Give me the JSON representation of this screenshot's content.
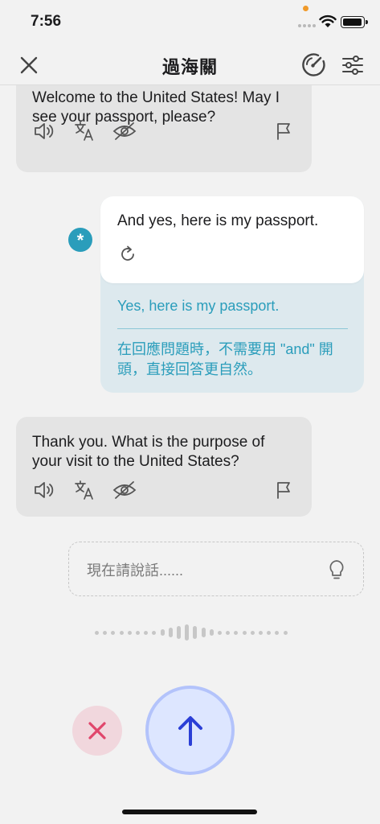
{
  "status_bar": {
    "time": "7:56"
  },
  "header": {
    "title": "過海關"
  },
  "messages": {
    "ai_1": {
      "text": "Welcome to the United States! May I see your passport, please?"
    },
    "user": {
      "text": "And yes, here is my passport.",
      "correction": "Yes, here is my passport.",
      "note": "在回應問題時，不需要用 \"and\" 開頭，直接回答更自然。"
    },
    "ai_2": {
      "text": "Thank you. What is the purpose of your visit to the United States?"
    }
  },
  "input": {
    "placeholder": "現在請說話......"
  },
  "badge": {
    "symbol": "*"
  },
  "colors": {
    "accent": "#2a9dbb",
    "ai_bubble": "#e4e4e4",
    "correction_bg": "#dde9ee",
    "send_ring": "#b3c3fb",
    "send_arrow": "#2b3fd6",
    "cancel_x": "#e0466b"
  },
  "icons": [
    "close-icon",
    "gauge-icon",
    "settings-sliders-icon",
    "speaker-icon",
    "translate-icon",
    "eye-off-icon",
    "flag-icon",
    "retry-icon",
    "lightbulb-icon",
    "x-icon",
    "arrow-up-icon"
  ]
}
